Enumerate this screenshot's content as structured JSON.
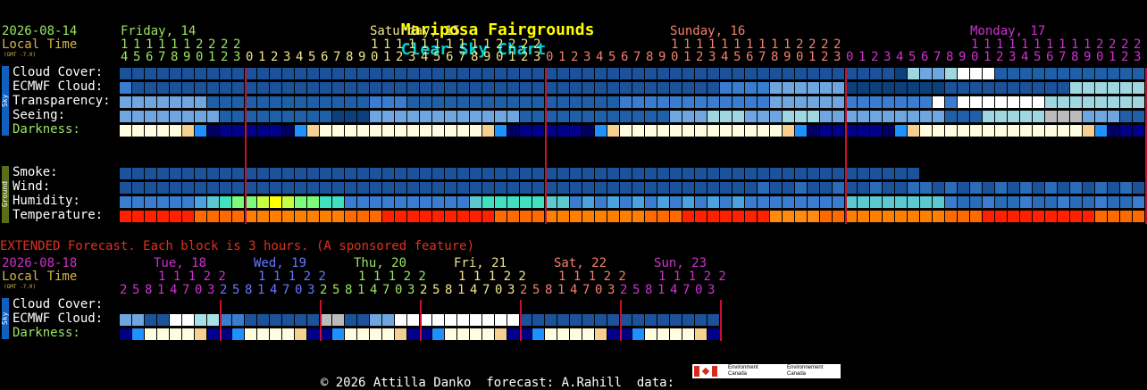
{
  "header": {
    "title_main": "Mariposa Fairgrounds",
    "title_suffix": "Clear Sky Chart",
    "date": "2026-08-14",
    "local_time": "Local Time",
    "gmt": "(GMT -7.0)",
    "days": [
      {
        "label": "Friday, 14",
        "color": "#9be564"
      },
      {
        "label": "Saturday, 15",
        "color": "#f0e68c"
      },
      {
        "label": "Sunday, 16",
        "color": "#f08070"
      },
      {
        "label": "Monday, 17",
        "color": "#cc33cc"
      }
    ],
    "hour_tens": "1 1 1 1 1 1 1 2 2 2 2                         1 1 1 1 1 1 1 1 1 1 2 2 2 2                   1 1 1 1 1 1 1 1 1 1 2 2 2 2                   1 1 1 1 1 1 1 1 1 1 2 2 2 2",
    "hours_row": "4567890123012345678901234567890123012345678901234567890123012345678901234567890123"
  },
  "rows_sky": {
    "label": "Sky",
    "items": [
      "Cloud Cover:",
      "ECMWF Cloud:",
      "Transparency:",
      "Seeing:",
      "Darkness:"
    ]
  },
  "rows_ground": {
    "label": "Ground",
    "items": [
      "Smoke:",
      "Wind:",
      "Humidity:",
      "Temperature:"
    ]
  },
  "extended": {
    "notice": "EXTENDED Forecast. Each block is 3 hours. (A sponsored feature)",
    "date": "2026-08-18",
    "local_time": "Local Time",
    "gmt": "(GMT -7.0)",
    "days": [
      {
        "label": "Tue, 18",
        "color": "#cc33cc"
      },
      {
        "label": "Wed, 19",
        "color": "#6677ff"
      },
      {
        "label": "Thu, 20",
        "color": "#9be564"
      },
      {
        "label": "Fri, 21",
        "color": "#f0e68c"
      },
      {
        "label": "Sat, 22",
        "color": "#f08070"
      },
      {
        "label": "Sun, 23",
        "color": "#cc33cc"
      }
    ],
    "tens_unit": "1 1 1 2 2",
    "hours_unit": "2 5 8 1 4 7 0 3",
    "rows_label": "Sky",
    "items": [
      "Cloud Cover:",
      "ECMWF Cloud:",
      "Darkness:"
    ]
  },
  "footer": {
    "copyright": "© 2026 Attilla Danko",
    "forecast": "forecast: A.Rahill",
    "data": "data:",
    "logo1_line1": "Environment",
    "logo1_line2": "Canada",
    "logo2_line1": "Environnement",
    "logo2_line2": "Canada"
  },
  "colors": {
    "title_yellow": "#ffff00",
    "title_cyan": "#00ced1",
    "green_text": "#9be564",
    "tan_text": "#d2b24c",
    "red_line": "#c8102e",
    "extended_red": "#e0301e",
    "sky_bar": "#1060c0",
    "ground_bar": "#5a6e1a"
  }
}
